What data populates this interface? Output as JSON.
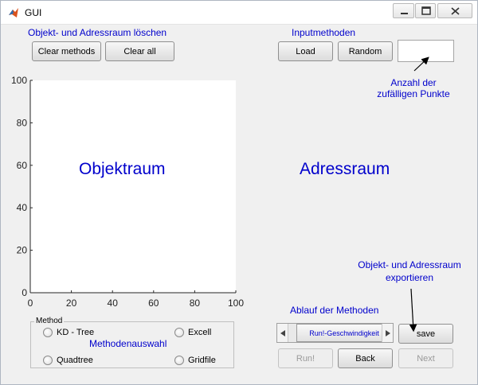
{
  "window": {
    "title": "GUI"
  },
  "labels": {
    "clear_section": "Objekt- und Adressraum löschen",
    "input_methods": "Inputmethoden",
    "random_points_line1": "Anzahl der",
    "random_points_line2": "zufälligen Punkte",
    "object_space": "Objektraum",
    "address_space": "Adressraum",
    "export_line1": "Objekt- und Adressraum",
    "export_line2": "exportieren",
    "method_flow": "Ablauf der Methoden",
    "method_selection": "Methodenauswahl"
  },
  "buttons": {
    "clear_methods": "Clear methods",
    "clear_all": "Clear all",
    "load": "Load",
    "random": "Random",
    "save": "save",
    "run": "Run!",
    "back": "Back",
    "next": "Next"
  },
  "random_points_input": {
    "value": ""
  },
  "method_group": {
    "title": "Method",
    "options": [
      "KD - Tree",
      "Excell",
      "Quadtree",
      "Gridfile"
    ]
  },
  "slider": {
    "label": "Run!-Geschwindigkeit"
  },
  "chart_data": {
    "type": "scatter",
    "title": "",
    "xlabel": "",
    "ylabel": "",
    "xlim": [
      0,
      100
    ],
    "ylim": [
      0,
      100
    ],
    "x_ticks": [
      0,
      20,
      40,
      60,
      80,
      100
    ],
    "y_ticks": [
      0,
      20,
      40,
      60,
      80,
      100
    ],
    "points": []
  }
}
